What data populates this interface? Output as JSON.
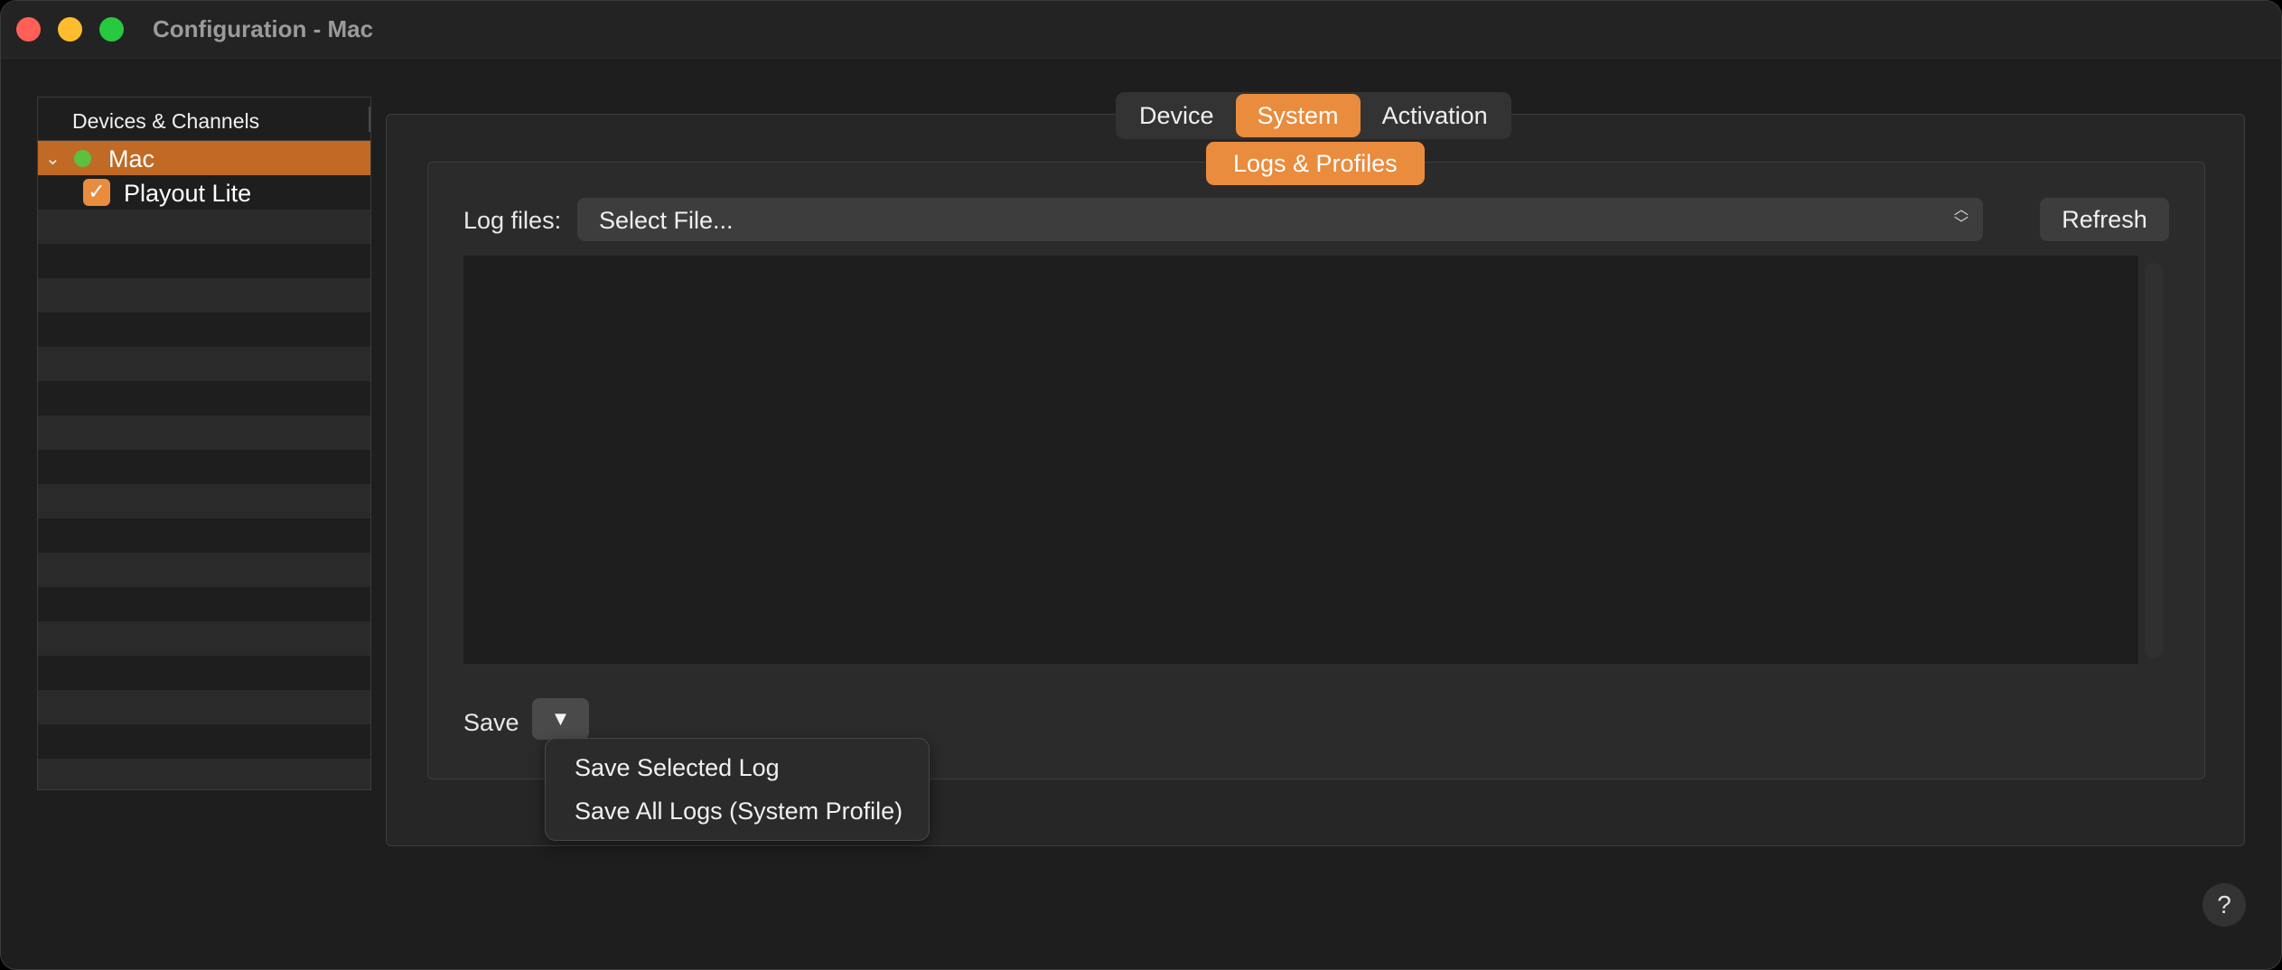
{
  "window": {
    "title": "Configuration - Mac"
  },
  "sidebar": {
    "header": "Devices & Channels",
    "items": [
      {
        "label": "Mac",
        "status": "online",
        "expanded": true,
        "selected": true
      },
      {
        "label": "Playout Lite",
        "checked": true
      }
    ]
  },
  "tabs": {
    "items": [
      {
        "label": "Device",
        "active": false
      },
      {
        "label": "System",
        "active": true
      },
      {
        "label": "Activation",
        "active": false
      }
    ]
  },
  "subtab": {
    "label": "Logs & Profiles"
  },
  "logs": {
    "label": "Log files:",
    "select_value": "Select File...",
    "refresh_label": "Refresh",
    "save_label": "Save",
    "dropdown_glyph": "▼",
    "menu": [
      "Save Selected Log",
      "Save All Logs (System Profile)"
    ]
  },
  "help": {
    "label": "?"
  },
  "colors": {
    "accent": "#e98c3d",
    "selection": "#c06a25",
    "status_online": "#5cc041"
  }
}
